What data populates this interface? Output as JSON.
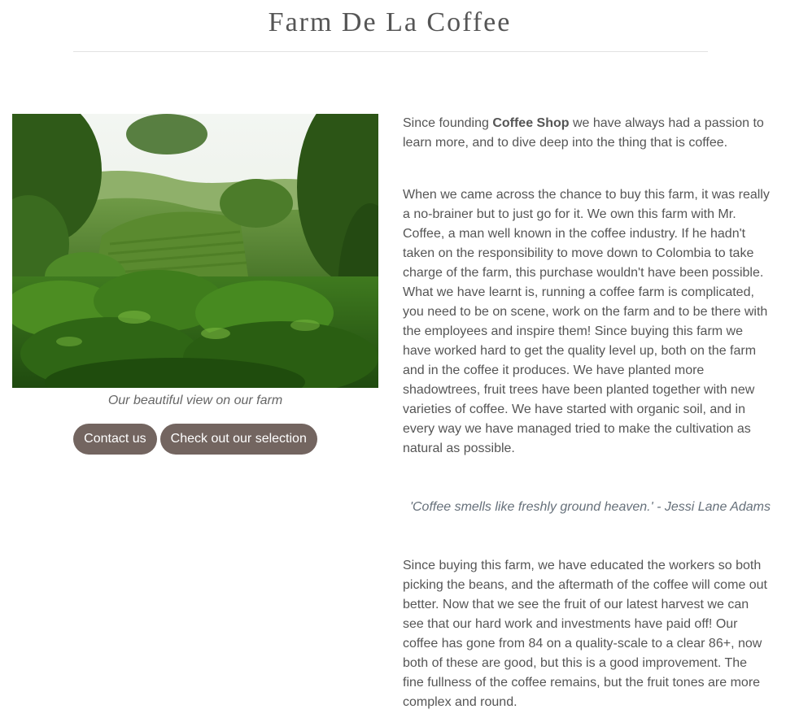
{
  "header": {
    "title": "Farm De La Coffee"
  },
  "hero": {
    "caption": "Our beautiful view on our farm",
    "buttons": {
      "contact_label": "Contact us",
      "selection_label": "Check out our selection"
    }
  },
  "content": {
    "p1_before": "Since founding ",
    "p1_strong": "Coffee Shop",
    "p1_after": " we have always had a passion to learn more, and to dive deep into the thing that is coffee.",
    "p2": "When we came across the chance to buy this farm, it was really a no-brainer but to just go for it. We own this farm with Mr. Coffee, a man well known in the coffee industry. If he hadn't taken on the responsibility to move down to Colombia to take charge of the farm, this purchase wouldn't have been possible. What we have learnt is, running a coffee farm is complicated, you need to be on scene, work on the farm and to be there with the employees and inspire them! Since buying this farm we have worked hard to get the quality level up, both on the farm and in the coffee it produces. We have planted more shadowtrees, fruit trees have been planted together with new varieties of coffee. We have started with organic soil, and in every way we have managed tried to make the cultivation as natural as possible.",
    "quote": "'Coffee smells like freshly ground heaven.' - Jessi Lane Adams",
    "p3": "Since buying this farm, we have educated the workers so both picking the beans, and the aftermath of the coffee will come out better. Now that we see the fruit of our latest harvest we can see that our hard work and investments have paid off! Our coffee has gone from 84 on a quality-scale to a clear 86+, now both of these are good, but this is a good improvement. The fine fullness of the coffee remains, but the fruit tones are more complex and round."
  },
  "colors": {
    "button_bg": "#736560",
    "button_text": "#ffffff",
    "body_text": "#555555",
    "quote_text": "#66707a",
    "divider": "#e2e2e2"
  }
}
